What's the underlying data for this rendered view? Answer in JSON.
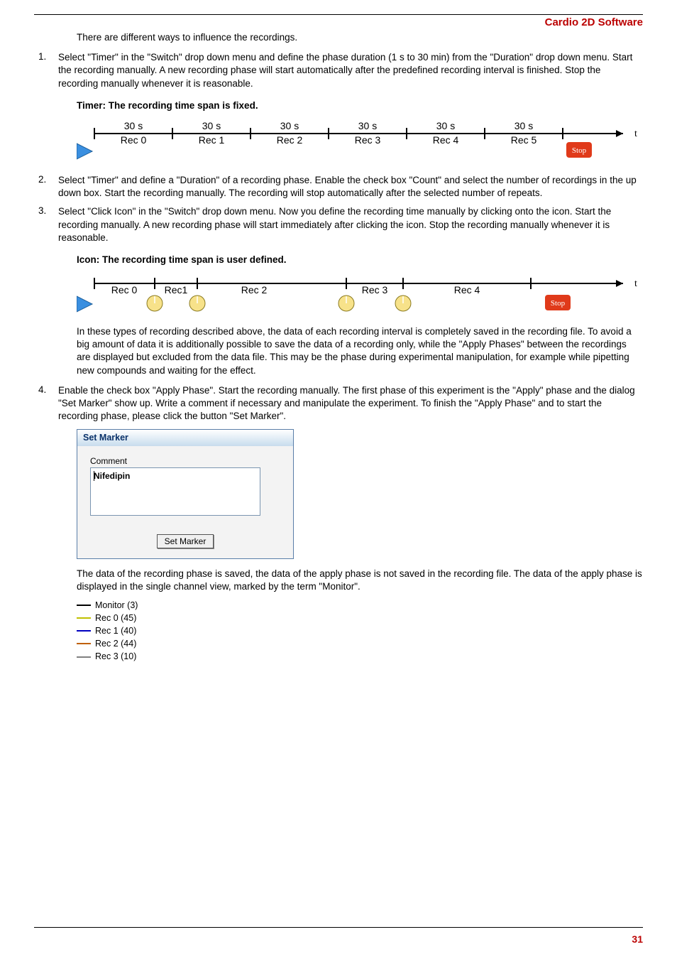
{
  "header": {
    "title": "Cardio 2D Software"
  },
  "intro": "There are different ways to influence the recordings.",
  "items": {
    "i1": {
      "num": "1.",
      "text": "Select \"Timer\" in the \"Switch\" drop down menu and define the phase duration (1 s to 30 min) from the \"Duration\" drop down menu. Start the recording manually. A new recording phase will start automatically after the predefined recording interval is finished. Stop the recording manually whenever it is reasonable."
    },
    "i2": {
      "num": "2.",
      "text": "Select \"Timer\" and define a \"Duration\" of a recording phase. Enable the check box \"Count\" and select the number of recordings in the up down box. Start the recording manually. The recording will stop automatically after the selected number of repeats."
    },
    "i3": {
      "num": "3.",
      "text": "Select \"Click Icon\" in the \"Switch\" drop down menu. Now you define the recording time manually by clicking onto the icon. Start the recording manually. A new recording phase will start immediately after clicking the icon. Stop the recording manually whenever it is reasonable."
    },
    "i4": {
      "num": "4.",
      "text": "Enable the check box \"Apply Phase\". Start the recording manually. The first phase of this experiment is the \"Apply\" phase and the dialog \"Set Marker\" show up. Write a comment if necessary and manipulate the experiment. To finish the \"Apply Phase\" and to start the recording phase, please click the button \"Set Marker\"."
    }
  },
  "headings": {
    "timer": "Timer: The recording time span is fixed.",
    "icon": "Icon: The recording time span is user defined."
  },
  "para": {
    "aboveItem4": "In these types of recording described above, the data of each recording interval is completely saved in the recording file. To avoid a big amount of data it is additionally possible to save the data of a recording only, while the \"Apply Phases\" between the recordings are displayed but excluded from the data file. This may be the phase during experimental manipulation, for example while pipetting new compounds and waiting for the effect.",
    "afterDialog": "The data of the recording phase is saved, the data of the apply phase is not saved in the recording file. The data of the apply phase is displayed in the single channel view, marked by the term \"Monitor\"."
  },
  "diagram1": {
    "dur": "30 s",
    "rec": [
      "Rec 0",
      "Rec 1",
      "Rec 2",
      "Rec 3",
      "Rec 4",
      "Rec 5"
    ],
    "stop": "Stop",
    "t": "t"
  },
  "diagram2": {
    "rec": [
      "Rec 0",
      "Rec1",
      "Rec 2",
      "Rec 3",
      "Rec 4"
    ],
    "stop": "Stop",
    "t": "t"
  },
  "dialog": {
    "title": "Set Marker",
    "commentLabel": "Comment",
    "commentValue": "Nifedipin",
    "button": "Set Marker"
  },
  "legend": {
    "items": [
      {
        "label": "Monitor  (3)",
        "color": "#000000"
      },
      {
        "label": "Rec 0  (45)",
        "color": "#c0c000"
      },
      {
        "label": "Rec 1  (40)",
        "color": "#0000c0"
      },
      {
        "label": "Rec 2  (44)",
        "color": "#c06000"
      },
      {
        "label": "Rec 3  (10)",
        "color": "#808080"
      }
    ]
  },
  "pageNum": "31"
}
